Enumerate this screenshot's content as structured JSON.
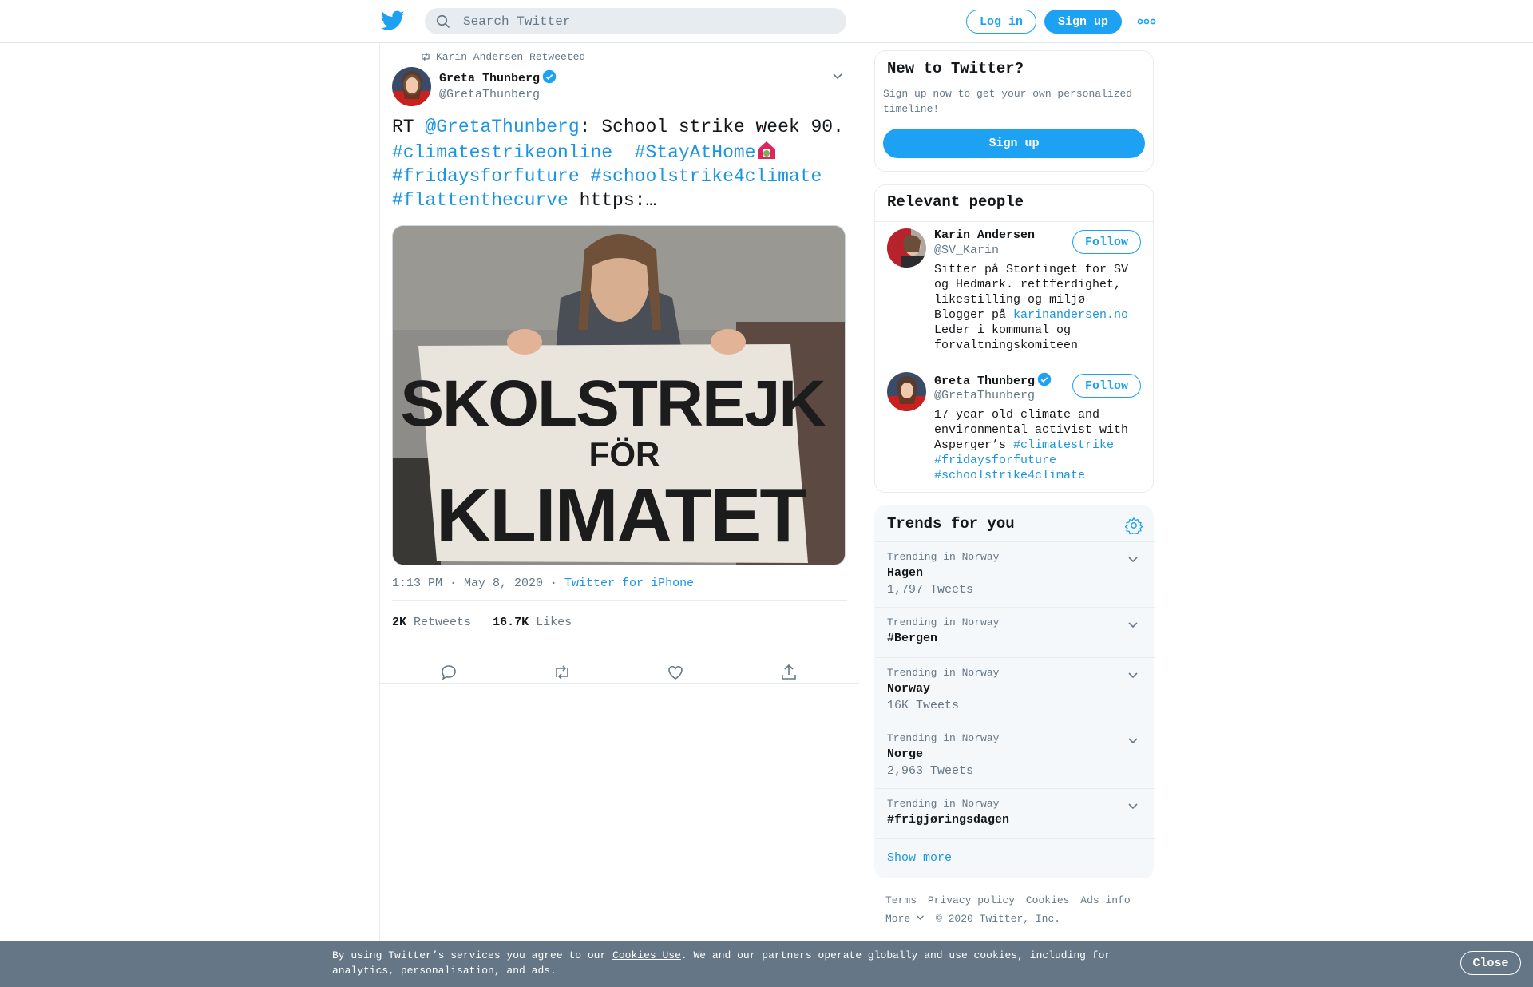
{
  "header": {
    "search_placeholder": "Search Twitter",
    "login_label": "Log in",
    "signup_label": "Sign up"
  },
  "tweet": {
    "retweeted_by": "Karin Andersen Retweeted",
    "author_name": "Greta Thunberg",
    "author_handle": "@GretaThunberg",
    "text_rt": "RT ",
    "text_mention": "@GretaThunberg",
    "text_body": ": School strike week 90.",
    "hashtag_1": "#climatestrikeonline",
    "hashtag_2": "#StayAtHome",
    "hashtag_3": "#fridaysforfuture",
    "hashtag_4": "#schoolstrike4climate",
    "hashtag_5": "#flattenthecurve",
    "text_link": " https:…",
    "sign_line_1": "SKOLSTREJK",
    "sign_line_2": "FÖR",
    "sign_line_3": "KLIMATET",
    "timestamp": "1:13 PM · May 8, 2020",
    "source": "Twitter for iPhone",
    "retweets_count": "2K",
    "retweets_label": "Retweets",
    "likes_count": "16.7K",
    "likes_label": "Likes"
  },
  "new_to_twitter": {
    "title": "New to Twitter?",
    "description": "Sign up now to get your own personalized timeline!",
    "button": "Sign up"
  },
  "relevant_people": {
    "title": "Relevant people",
    "people": [
      {
        "name": "Karin Andersen",
        "handle": "@SV_Karin",
        "follow_label": "Follow",
        "bio_1": "Sitter på Stortinget for SV og Hedmark. rettferdighet, likestilling og miljø Blogger på ",
        "bio_link": "karinandersen.no",
        "bio_2": " Leder i kommunal og forvaltningskomiteen"
      },
      {
        "name": "Greta Thunberg",
        "handle": "@GretaThunberg",
        "follow_label": "Follow",
        "bio_1": "17 year old climate and environmental activist with Asperger’s ",
        "bio_tag_1": "#climatestrike",
        "bio_tag_2": "#fridaysforfuture",
        "bio_tag_3": "#schoolstrike4climate"
      }
    ]
  },
  "trends": {
    "title": "Trends for you",
    "items": [
      {
        "context": "Trending in Norway",
        "name": "Hagen",
        "count": "1,797 Tweets"
      },
      {
        "context": "Trending in Norway",
        "name": "#Bergen",
        "count": ""
      },
      {
        "context": "Trending in Norway",
        "name": "Norway",
        "count": "16K Tweets"
      },
      {
        "context": "Trending in Norway",
        "name": "Norge",
        "count": "2,963 Tweets"
      },
      {
        "context": "Trending in Norway",
        "name": "#frigjøringsdagen",
        "count": ""
      }
    ],
    "show_more": "Show more"
  },
  "footer": {
    "terms": "Terms",
    "privacy": "Privacy policy",
    "cookies": "Cookies",
    "ads": "Ads info",
    "more": "More",
    "copyright": "© 2020 Twitter, Inc."
  },
  "cookie_bar": {
    "text_1": "By using Twitter’s services you agree to our ",
    "link": "Cookies Use",
    "text_2": ". We and our partners operate globally and use cookies, including for analytics, personalisation, and ads.",
    "close": "Close"
  },
  "colors": {
    "brand": "#1da1f2",
    "link": "#1b95e0",
    "muted": "#657786",
    "cookie_bar": "#657786"
  },
  "icons": [
    "twitter-bird-icon",
    "search-icon",
    "more-dots-icon",
    "retweet-small-icon",
    "verified-icon",
    "chevron-down-icon",
    "reply-icon",
    "retweet-icon",
    "like-icon",
    "share-icon",
    "gear-icon"
  ]
}
